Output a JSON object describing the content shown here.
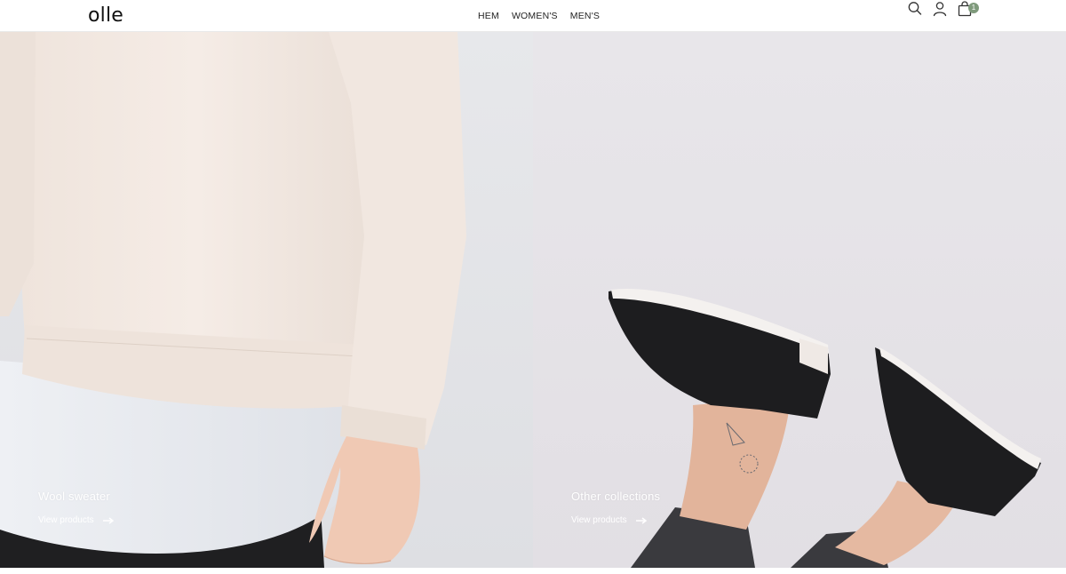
{
  "brand": {
    "logo_text": "olle"
  },
  "nav": {
    "items": [
      {
        "label": "HEM"
      },
      {
        "label": "WOMEN'S"
      },
      {
        "label": "MEN'S"
      }
    ]
  },
  "header_icons": {
    "search": "search-icon",
    "account": "user-icon",
    "cart": "shopping-bag-icon",
    "cart_count": "1",
    "badge_color": "#7f9a7c"
  },
  "hero": {
    "left": {
      "title": "Wool sweater",
      "link_label": "View products",
      "image": "model in cream sweater over white shirt"
    },
    "right": {
      "title": "Other collections",
      "link_label": "View products",
      "image": "two legs in black sneakers with paper plane tattoo"
    }
  }
}
